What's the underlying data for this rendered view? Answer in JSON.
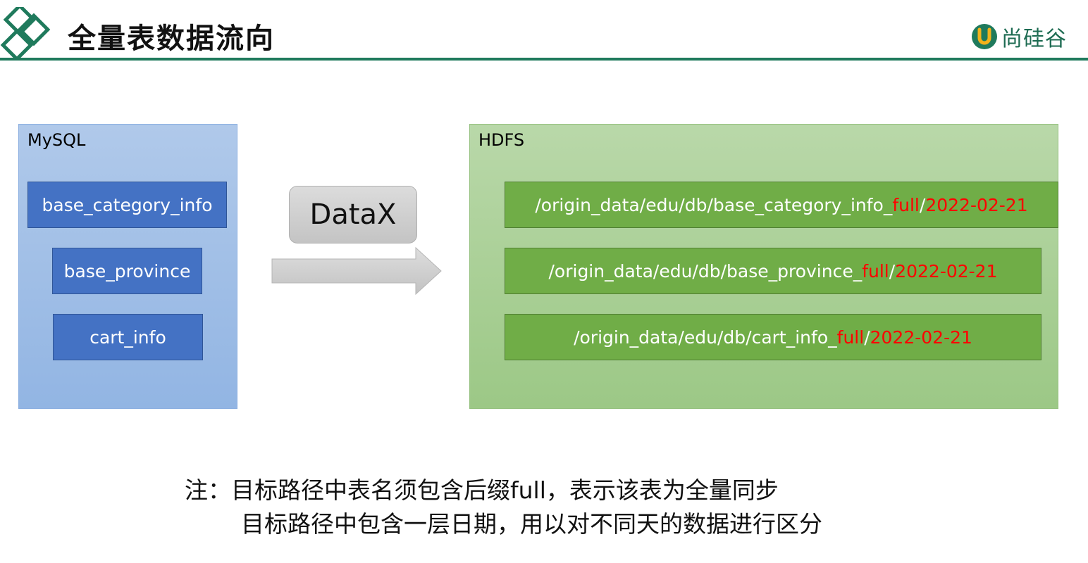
{
  "header": {
    "title": "全量表数据流向",
    "brand_text": "尚硅谷"
  },
  "colors": {
    "accent": "#1f7a5c",
    "mysql_panel": "#a4c2e8",
    "table_box": "#4472c4",
    "hdfs_panel": "#a9d08e",
    "path_box": "#70ad47",
    "highlight": "#ff0000"
  },
  "source": {
    "label": "MySQL",
    "tables": [
      "base_category_info",
      "base_province",
      "cart_info"
    ]
  },
  "tool": {
    "label": "DataX"
  },
  "target": {
    "label": "HDFS",
    "paths": [
      {
        "prefix": "/origin_data/edu/db/base_category_info_",
        "suffix": "full",
        "sep": "/",
        "date": "2022-02-21"
      },
      {
        "prefix": "/origin_data/edu/db/base_province_",
        "suffix": "full",
        "sep": "/",
        "date": "2022-02-21"
      },
      {
        "prefix": "/origin_data/edu/db/cart_info_",
        "suffix": "full",
        "sep": "/",
        "date": "2022-02-21"
      }
    ]
  },
  "notes": {
    "line1": "注：目标路径中表名须包含后缀full，表示该表为全量同步",
    "line2": "目标路径中包含一层日期，用以对不同天的数据进行区分"
  }
}
